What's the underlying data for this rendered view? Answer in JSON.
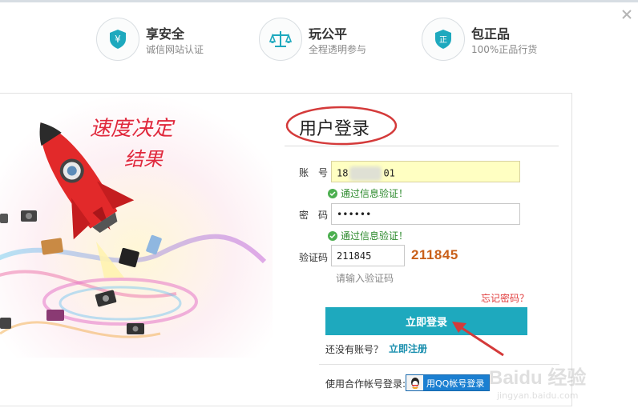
{
  "features": [
    {
      "icon": "yen-shield-icon",
      "title": "享安全",
      "subtitle": "诚信网站认证"
    },
    {
      "icon": "scale-icon",
      "title": "玩公平",
      "subtitle": "全程透明参与"
    },
    {
      "icon": "certified-shield-icon",
      "title": "包正品",
      "subtitle": "100%正品行货"
    }
  ],
  "banner": {
    "slogan_line1": "速度决定",
    "slogan_line2": "结果"
  },
  "login": {
    "title": "用户登录",
    "account_label": "账　号",
    "account_prefix": "18",
    "account_suffix": "01",
    "account_ok": "通过信息验证！",
    "password_label": "密　码",
    "password_value": "••••••",
    "password_ok": "通过信息验证！",
    "captcha_label": "验证码",
    "captcha_value": "211845",
    "captcha_image_text": "211845",
    "captcha_hint": "请输入验证码",
    "forgot_link": "忘记密码？",
    "submit_label": "立即登录",
    "no_account_text": "还没有账号？",
    "register_link": "立即注册",
    "partner_text": "使用合作帐号登录:",
    "qq_button_label": "用QQ帐号登录"
  },
  "watermark": {
    "main": "Baidu 经验",
    "sub": "jingyan.baidu.com"
  },
  "colors": {
    "accent": "#1ea9be",
    "success": "#2c8a2c",
    "link_red": "#e03b3b",
    "captcha_orange": "#c9601a",
    "annotation_red": "#d43a3a"
  }
}
